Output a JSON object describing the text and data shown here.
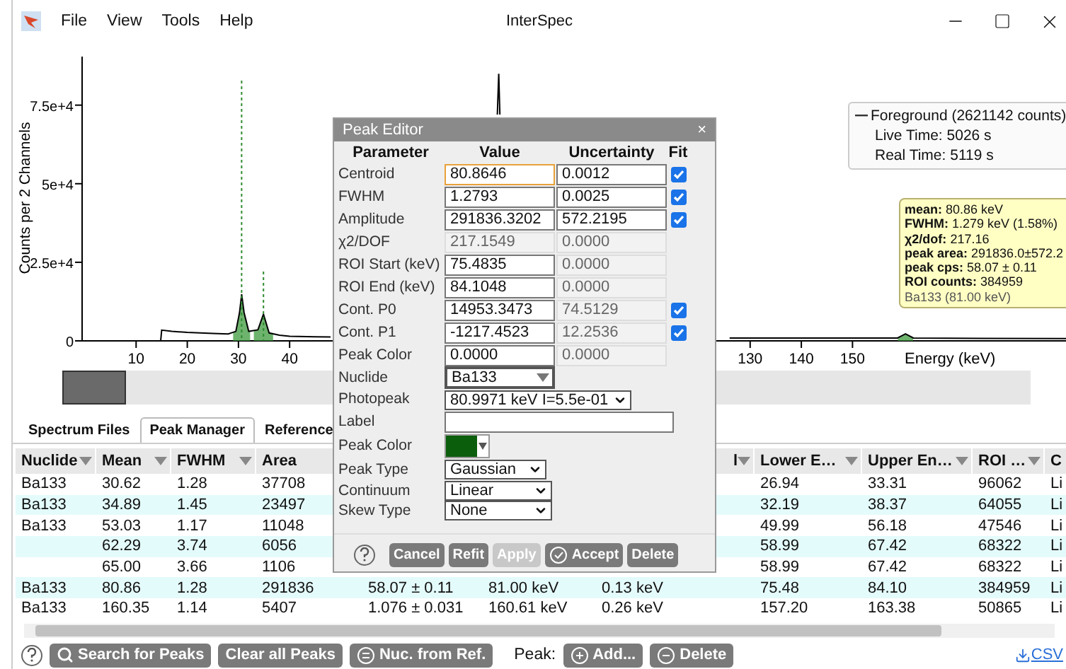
{
  "window": {
    "title": "InterSpec",
    "menu": [
      "File",
      "View",
      "Tools",
      "Help"
    ]
  },
  "chart": {
    "legend": {
      "series_label": "Foreground (2621142 counts)",
      "live_time": "Live Time: 5026 s",
      "real_time": "Real Time: 5119 s"
    },
    "tooltip": [
      "**mean:** 80.86 keV",
      "**FWHM:** 1.279 keV (1.58%)",
      "**χ2/dof:** 217.16",
      "**peak area:** 291836.0±572.2",
      "**peak cps:** 58.07 ± 0.11",
      "**ROI counts:** 384959",
      "Ba133 (81.00 keV)"
    ],
    "chart_data": {
      "type": "line",
      "xlabel": "Energy (keV)",
      "ylabel": "Counts per 2 Channels",
      "xlim": [
        0,
        192
      ],
      "ylim": [
        0,
        90000
      ],
      "xticks": [
        10,
        20,
        30,
        40,
        130,
        140,
        150
      ],
      "yticks": [
        {
          "value": 0,
          "label": "0"
        },
        {
          "value": 25000,
          "label": "2.5e+4"
        },
        {
          "value": 50000,
          "label": "5e+4"
        },
        {
          "value": 75000,
          "label": "7.5e+4"
        }
      ],
      "x": [
        0,
        14.8,
        15,
        17,
        20,
        25,
        28,
        29.5,
        30.2,
        30.62,
        31.1,
        32,
        33.8,
        34.89,
        36,
        38,
        40,
        45,
        48,
        60,
        80.6,
        80.86,
        81.1,
        100,
        126,
        130,
        140,
        158.8,
        160.35,
        161.9,
        175,
        192
      ],
      "series": [
        {
          "color": "#000000",
          "values": [
            0,
            0,
            3400,
            3000,
            2700,
            2400,
            2200,
            3000,
            9000,
            14800,
            9000,
            3000,
            3500,
            8500,
            2500,
            1800,
            1500,
            1300,
            1200,
            null,
            72000,
            85000,
            72000,
            null,
            900,
            900,
            900,
            900,
            2200,
            900,
            800,
            700
          ]
        }
      ],
      "ref_lines": [
        {
          "axis": "x",
          "value": 30.62
        },
        {
          "axis": "x",
          "value": 34.89
        }
      ]
    }
  },
  "tabs": [
    {
      "label": "Spectrum Files",
      "selected": false
    },
    {
      "label": "Peak Manager",
      "selected": true
    },
    {
      "label": "Reference",
      "selected": false
    }
  ],
  "peak_table": {
    "columns": [
      "Nuclide",
      "Mean",
      "FWHM",
      "Area",
      null,
      null,
      null,
      "l",
      "Lower E…",
      "Upper En…",
      "ROI …",
      "C"
    ],
    "rows": [
      {
        "cells": [
          "Ba133",
          "30.62",
          "1.28",
          "37708",
          null,
          null,
          null,
          null,
          "26.94",
          "33.31",
          "96062",
          "Li"
        ]
      },
      {
        "cells": [
          "Ba133",
          "34.89",
          "1.45",
          "23497",
          null,
          null,
          null,
          null,
          "32.19",
          "38.37",
          "64055",
          "Li"
        ]
      },
      {
        "cells": [
          "Ba133",
          "53.03",
          "1.17",
          "11048",
          null,
          null,
          null,
          null,
          "49.99",
          "56.18",
          "47546",
          "Li"
        ]
      },
      {
        "cells": [
          null,
          "62.29",
          "3.74",
          "6056",
          null,
          null,
          null,
          null,
          "58.99",
          "67.42",
          "68322",
          "Li"
        ]
      },
      {
        "cells": [
          null,
          "65.00",
          "3.66",
          "1106",
          null,
          null,
          null,
          null,
          "58.99",
          "67.42",
          "68322",
          "Li"
        ]
      },
      {
        "cells": [
          "Ba133",
          "80.86",
          "1.28",
          "291836",
          "58.07 ± 0.11",
          "81.00 keV",
          "0.13 keV",
          null,
          "75.48",
          "84.10",
          "384959",
          "Li"
        ]
      },
      {
        "cells": [
          "Ba133",
          "160.35",
          "1.14",
          "5407",
          "1.076 ± 0.031",
          "160.61 keV",
          "0.26 keV",
          null,
          "157.20",
          "163.38",
          "50865",
          "Li"
        ]
      }
    ]
  },
  "toolbar": {
    "buttons": [
      {
        "label": "Search for Peaks",
        "kind": "search"
      },
      {
        "label": "Clear all Peaks",
        "kind": "plain"
      },
      {
        "label": "Nuc. from Ref.",
        "kind": "list"
      }
    ],
    "peak_label": "Peak:",
    "peak_buttons": [
      {
        "label": "Add...",
        "kind": "add"
      },
      {
        "label": "Delete",
        "kind": "remove"
      }
    ],
    "csv": "CSV"
  },
  "peak_editor": {
    "title": "Peak Editor",
    "close": "×",
    "headers": [
      "Parameter",
      "Value",
      "Uncertainty",
      "Fit"
    ],
    "params": [
      {
        "label": "Centroid",
        "value": "80.8646",
        "uncertainty": "0.0012",
        "value_disabled": false,
        "uncertainty_disabled": false,
        "focused": true,
        "fit": true
      },
      {
        "label": "FWHM",
        "value": "1.2793",
        "uncertainty": "0.0025",
        "value_disabled": false,
        "uncertainty_disabled": false,
        "focused": false,
        "fit": true
      },
      {
        "label": "Amplitude",
        "value": "291836.3202",
        "uncertainty": "572.2195",
        "value_disabled": false,
        "uncertainty_disabled": false,
        "focused": false,
        "fit": true
      },
      {
        "label": "χ2/DOF",
        "value": "217.1549",
        "uncertainty": "0.0000",
        "value_disabled": true,
        "uncertainty_disabled": true,
        "focused": false
      },
      {
        "label": "ROI Start (keV)",
        "value": "75.4835",
        "uncertainty": "0.0000",
        "value_disabled": false,
        "uncertainty_disabled": true,
        "focused": false
      },
      {
        "label": "ROI End (keV)",
        "value": "84.1048",
        "uncertainty": "0.0000",
        "value_disabled": false,
        "uncertainty_disabled": true,
        "focused": false
      },
      {
        "label": "Cont. P0",
        "value": "14953.3473",
        "uncertainty": "74.5129",
        "value_disabled": false,
        "uncertainty_disabled": true,
        "focused": false,
        "fit": true
      },
      {
        "label": "Cont. P1",
        "value": "-1217.4523",
        "uncertainty": "12.2536",
        "value_disabled": false,
        "uncertainty_disabled": true,
        "focused": false,
        "fit": true
      },
      {
        "label": "Peak Color",
        "value": "0.0000",
        "uncertainty": "0.0000",
        "value_disabled": false,
        "uncertainty_disabled": true,
        "focused": false
      }
    ],
    "nuclide": {
      "label": "Nuclide",
      "value": "Ba133"
    },
    "photopeak": {
      "label": "Photopeak",
      "value": "80.9971 keV I=5.5e-01"
    },
    "label_field": {
      "label": "Label"
    },
    "peak_color": {
      "label": "Peak Color",
      "color": "#0b5e0b"
    },
    "selects": [
      {
        "label": "Peak Type",
        "value": "Gaussian"
      },
      {
        "label": "Continuum",
        "value": "Linear"
      },
      {
        "label": "Skew Type",
        "value": "None"
      }
    ],
    "buttons": [
      {
        "label": "Cancel",
        "disabled": false,
        "kind": "plain"
      },
      {
        "label": "Refit",
        "disabled": false,
        "kind": "plain"
      },
      {
        "label": "Apply",
        "disabled": true,
        "kind": "plain"
      },
      {
        "label": "Accept",
        "disabled": false,
        "kind": "accept"
      },
      {
        "label": "Delete",
        "disabled": false,
        "kind": "plain"
      }
    ]
  }
}
